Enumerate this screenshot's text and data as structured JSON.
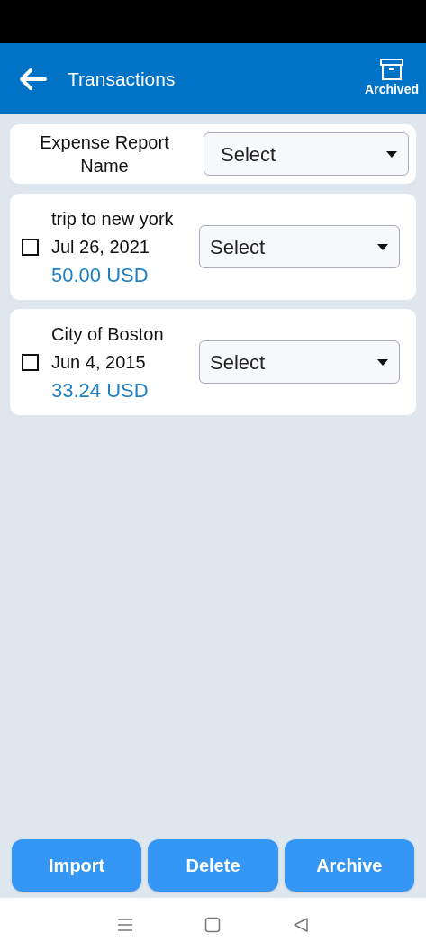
{
  "header": {
    "title": "Transactions",
    "archived_label": "Archived"
  },
  "report": {
    "label": "Expense Report Name",
    "select": "Select"
  },
  "transactions": [
    {
      "name": "trip to new york",
      "date": "Jul 26, 2021",
      "amount": "50.00 USD",
      "checked": false,
      "select": "Select"
    },
    {
      "name": "City of Boston",
      "date": "Jun 4, 2015",
      "amount": "33.24 USD",
      "checked": false,
      "select": "Select"
    }
  ],
  "buttons": [
    "Import",
    "Delete",
    "Archive"
  ]
}
